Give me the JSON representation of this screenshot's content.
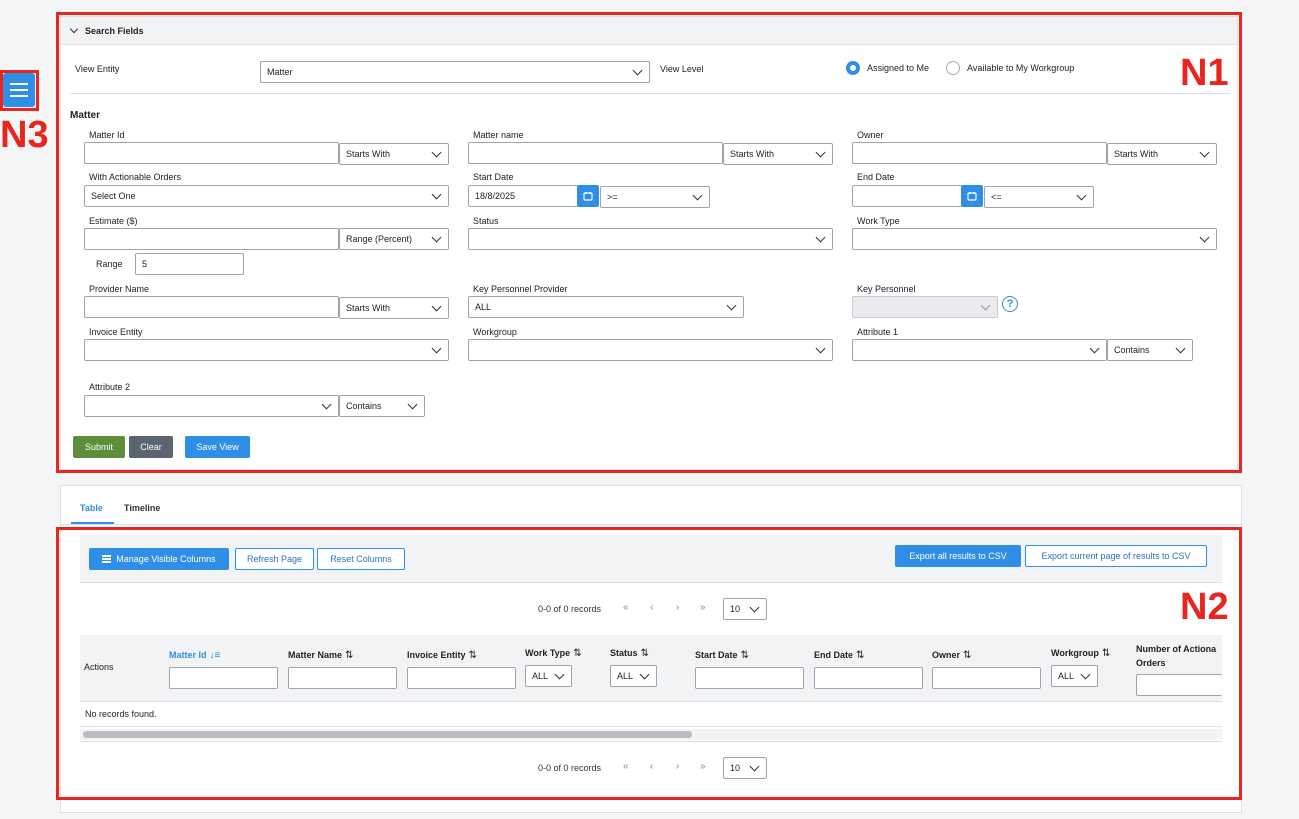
{
  "annotations": {
    "n1": "N1",
    "n2": "N2",
    "n3": "N3"
  },
  "menu_button": {
    "icon": "hamburger-icon"
  },
  "search": {
    "header": "Search Fields",
    "view_entity_label": "View Entity",
    "view_entity_value": "Matter",
    "view_level_label": "View Level",
    "view_level_options": [
      "Assigned to Me",
      "Available to My Workgroup"
    ],
    "view_level_selected": "Assigned to Me",
    "section_title": "Matter",
    "fields": {
      "matter_id": {
        "label": "Matter Id",
        "value": "",
        "op": "Starts With"
      },
      "matter_name": {
        "label": "Matter name",
        "value": "",
        "op": "Starts With"
      },
      "owner": {
        "label": "Owner",
        "value": "",
        "op": "Starts With"
      },
      "actionable": {
        "label": "With Actionable Orders",
        "value": "Select One"
      },
      "start_date": {
        "label": "Start Date",
        "value": "18/8/2025",
        "op": ">="
      },
      "end_date": {
        "label": "End Date",
        "value": "",
        "op": "<="
      },
      "estimate": {
        "label": "Estimate ($)",
        "value": "",
        "op": "Range (Percent)"
      },
      "range": {
        "label": "Range",
        "value": "5"
      },
      "status": {
        "label": "Status",
        "value": ""
      },
      "work_type": {
        "label": "Work Type",
        "value": ""
      },
      "provider_name": {
        "label": "Provider Name",
        "value": "",
        "op": "Starts With"
      },
      "kp_provider": {
        "label": "Key Personnel Provider",
        "value": "ALL"
      },
      "key_personnel": {
        "label": "Key Personnel",
        "value": ""
      },
      "invoice_entity": {
        "label": "Invoice Entity",
        "value": ""
      },
      "workgroup": {
        "label": "Workgroup",
        "value": ""
      },
      "attribute1": {
        "label": "Attribute 1",
        "value": "",
        "op": "Contains"
      },
      "attribute2": {
        "label": "Attribute 2",
        "value": "",
        "op": "Contains"
      }
    },
    "buttons": {
      "submit": "Submit",
      "clear": "Clear",
      "save_view": "Save View"
    }
  },
  "results": {
    "tabs": [
      "Table",
      "Timeline"
    ],
    "active_tab": "Table",
    "toolbar": {
      "manage_columns": "Manage Visible Columns",
      "refresh": "Refresh Page",
      "reset": "Reset Columns",
      "export_all": "Export all results to CSV",
      "export_page": "Export current page of results to CSV"
    },
    "pagination": {
      "summary": "0-0 of 0 records",
      "first": "«",
      "prev": "‹",
      "next": "›",
      "last": "»",
      "page_size": "10"
    },
    "columns": {
      "actions": "Actions",
      "matter_id": "Matter Id",
      "matter_name": "Matter Name",
      "invoice_entity": "Invoice Entity",
      "work_type": "Work Type",
      "status": "Status",
      "start_date": "Start Date",
      "end_date": "End Date",
      "owner": "Owner",
      "workgroup": "Workgroup",
      "num_actionable_1": "Number of Actiona",
      "num_actionable_2": "Orders"
    },
    "filter_all": "ALL",
    "empty": "No records found."
  }
}
